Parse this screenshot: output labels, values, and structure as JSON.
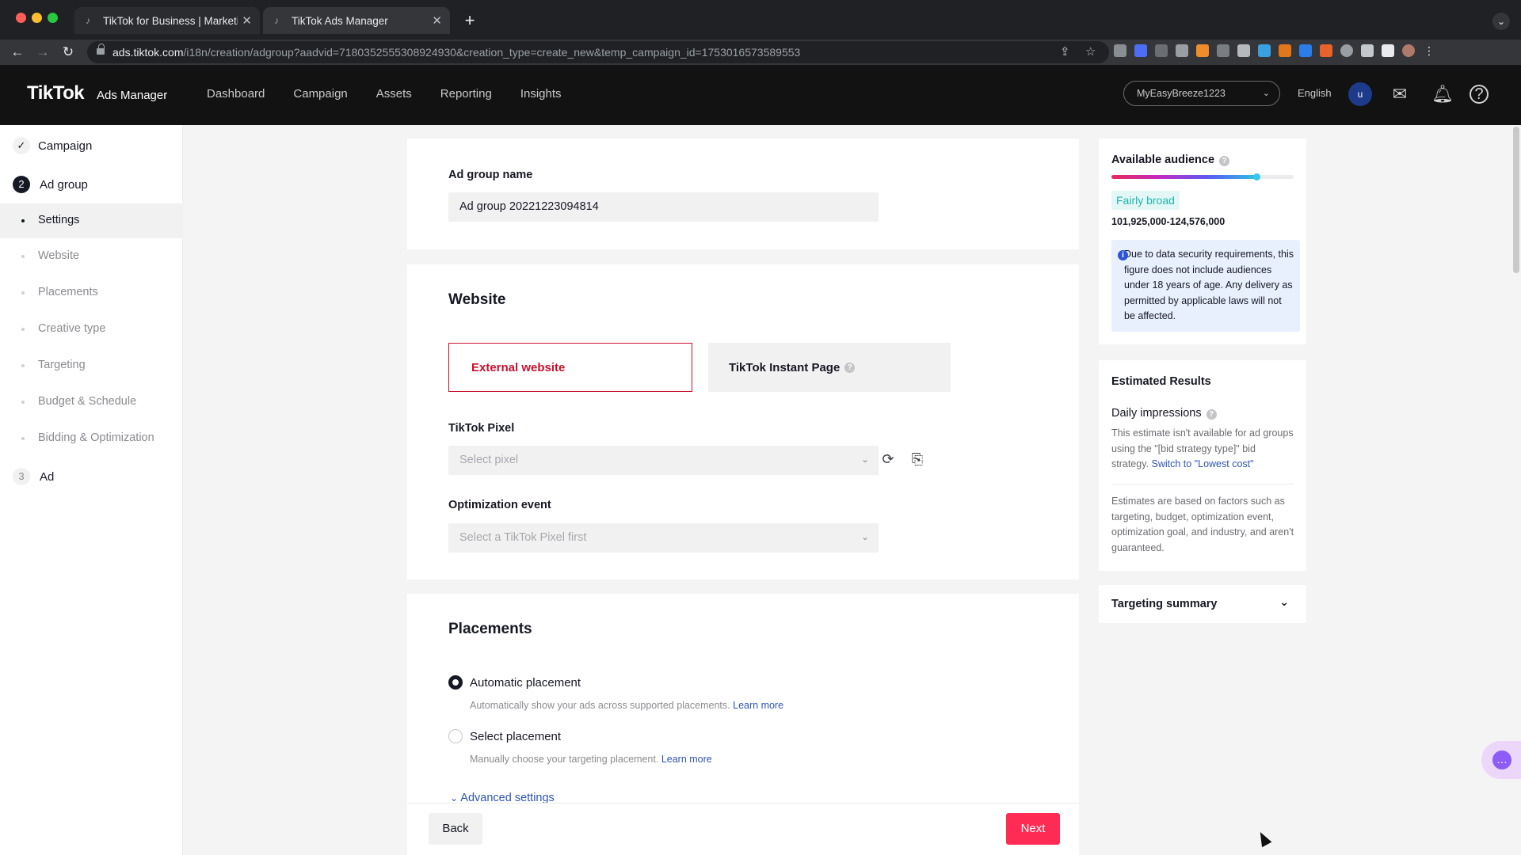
{
  "browser": {
    "tabs": [
      {
        "title": "TikTok for Business | Marketing"
      },
      {
        "title": "TikTok Ads Manager"
      }
    ],
    "url_host": "ads.tiktok.com",
    "url_path": "/i18n/creation/adgroup?aadvid=7180352555308924930&creation_type=create_new&temp_campaign_id=1753016573589553"
  },
  "header": {
    "logo": "TikTok",
    "logo_sub": "Ads Manager",
    "nav": [
      "Dashboard",
      "Campaign",
      "Assets",
      "Reporting",
      "Insights"
    ],
    "account": "MyEasyBreeze1223",
    "language": "English",
    "avatar_letter": "u"
  },
  "sidebar": {
    "steps": {
      "campaign": {
        "label": "Campaign"
      },
      "adgroup": {
        "badge": "2",
        "label": "Ad group"
      },
      "ad": {
        "badge": "3",
        "label": "Ad"
      }
    },
    "subitems": [
      "Settings",
      "Website",
      "Placements",
      "Creative type",
      "Targeting",
      "Budget & Schedule",
      "Bidding & Optimization"
    ]
  },
  "adgroup": {
    "label": "Ad group name",
    "value": "Ad group 20221223094814"
  },
  "website": {
    "title": "Website",
    "option_external": "External website",
    "option_instant": "TikTok Instant Page",
    "pixel_label": "TikTok Pixel",
    "pixel_placeholder": "Select pixel",
    "event_label": "Optimization event",
    "event_placeholder": "Select a TikTok Pixel first"
  },
  "placements": {
    "title": "Placements",
    "auto_label": "Automatic placement",
    "auto_desc": "Automatically show your ads across supported placements.",
    "select_label": "Select placement",
    "select_desc": "Manually choose your targeting placement.",
    "learn_more": "Learn more",
    "advanced": "Advanced settings"
  },
  "footer": {
    "back": "Back",
    "next": "Next"
  },
  "audience": {
    "title": "Available audience",
    "level": 0.8,
    "tag": "Fairly broad",
    "range": "101,925,000-124,576,000",
    "note": "Due to data security requirements, this figure does not include audiences under 18 years of age. Any delivery as permitted by applicable laws will not be affected."
  },
  "estimated": {
    "title": "Estimated Results",
    "daily_label": "Daily impressions",
    "daily_note": "This estimate isn't available for ad groups using the \"[bid strategy type]\" bid strategy.",
    "switch_link": "Switch to \"Lowest cost\"",
    "disclaimer": "Estimates are based on factors such as targeting, budget, optimization event, optimization goal, and industry, and aren't guaranteed."
  },
  "targeting_summary": {
    "title": "Targeting summary"
  },
  "colors": {
    "brand": "#fe2c55",
    "selected_border": "#c8102e",
    "link": "#2f54b4"
  }
}
